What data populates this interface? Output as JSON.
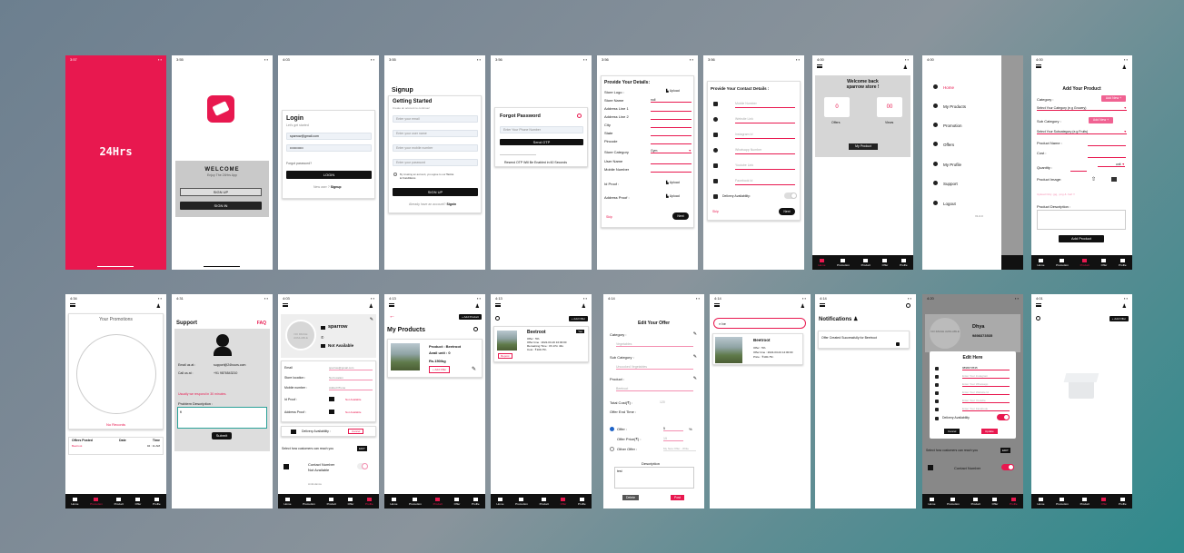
{
  "times": {
    "s1": "3:57",
    "s2": "3:55",
    "s3": "4:03",
    "s4": "3:55",
    "s5": "3:56",
    "s6": "3:56",
    "s7": "3:56",
    "s8": "4:00",
    "s9": "4:00",
    "s10": "4:00",
    "r1": "4:34",
    "r2": "4:31",
    "r3": "4:03",
    "r4": "4:13",
    "r5": "4:13",
    "r6": "4:14",
    "r7": "4:14",
    "r8": "4:14",
    "r9": "4:20",
    "r10": "4:01"
  },
  "splash": {
    "title": "24Hrs"
  },
  "welcome": {
    "title": "WELCOME",
    "subtitle": "Enjoy The 24Hrs App",
    "signup": "SIGN UP",
    "signin": "SIGN IN"
  },
  "login": {
    "title": "Login",
    "subtitle": "Let's get started",
    "email": "sparrow@gmail.com",
    "password": "••••••••••••",
    "forgot": "Forgot password?",
    "button": "LOGIN",
    "new_user": "New user ?",
    "signup_link": "Signup"
  },
  "signup": {
    "title": "Signup",
    "heading": "Getting Started",
    "sub": "Create an account to continue!",
    "email_ph": "Enter your email",
    "user_ph": "Enter your user name",
    "mobile_ph": "Enter your mobile number",
    "pass_ph": "Enter your password",
    "terms": "By creating an account, you agree to our",
    "terms_link": "Terms & Conditions",
    "button": "SIGN UP",
    "have": "Already have an account?",
    "signin": "Signin"
  },
  "forgot": {
    "title": "Forgot Password",
    "phone_ph": "Enter Your Phone Number",
    "button": "Send OTP",
    "otp_note": "Resend OTP Will Be Enabled in 60 Seconds"
  },
  "details": {
    "title": "Provide Your Details:",
    "fields": [
      "Store Logo :",
      "Store Name",
      "Address Line 1",
      "Address Line 2",
      "City",
      "State",
      "Pincode",
      "Store Category",
      "User Name",
      "Mobile Number",
      "Id Proof :",
      "Address Proof :"
    ],
    "upload": "Upload",
    "store_name": "null",
    "category": "Gym",
    "skip": "Skip",
    "next": "Next"
  },
  "contact": {
    "title": "Provide Your Contact Details :",
    "fields": [
      "Mobile Number",
      "Website Link",
      "Instagram Id",
      "Whatsapp Number",
      "Youtube Link",
      "Facebook Id"
    ],
    "delivery": "Delivery Availability:",
    "skip": "Skip",
    "next": "Next"
  },
  "home": {
    "welcome": "Welcome back",
    "store": "sparrow store !",
    "offers_val": "0",
    "views_val": "00",
    "offers": "Offers",
    "views": "Views",
    "my_product": "My Product"
  },
  "drawer": {
    "items": [
      "Home",
      "My Products",
      "Promotion",
      "Offers",
      "My Profile",
      "Support",
      "Logout"
    ],
    "version": "V1.0.0"
  },
  "add_product": {
    "title": "Add Your Product",
    "category": "Category :",
    "add_new": "Add New +",
    "cat_ph": "Select Your Category (e.g Grocery)",
    "subcategory": "Sub Category :",
    "subcat_ph": "Select Your Subcategory (e.g Fruits)",
    "name": "Product Name :",
    "cost": "Cost :",
    "qty": "Quantity :",
    "unit": "unit",
    "image": "Product Image:",
    "note": "Upload Only .jpg, .png & .heif !!",
    "desc": "Product Description :",
    "button": "Add Product"
  },
  "promotions": {
    "title": "Your Promotions",
    "no_records": "No Records",
    "cols": [
      "Offers Posted",
      "Date",
      "Time"
    ],
    "row": [
      "Beetroot",
      "",
      "04 : 11 AM"
    ]
  },
  "support": {
    "title": "Support",
    "faq": "FAQ",
    "email_label": "Email us at :",
    "email": "support@24hours.com",
    "call_label": "Call us at :",
    "phone": "+91 9876543210",
    "note": "Usually we respond in 30 minutes.",
    "desc_label": "Problem Description :",
    "desc_val": "fi",
    "button": "Submit"
  },
  "profile": {
    "no_image": "NO IMAGE AVAILABLE",
    "name": "sparrow",
    "status": "Not Available",
    "fields": [
      "Email",
      "Store location :",
      "Mobile number :",
      "Id Proof :",
      "Address Proof :"
    ],
    "email": "sparrow@gmail.com",
    "location": "Not location",
    "mobile": "Added Phone",
    "idproof": "Not Available",
    "addrproof": "Not Available",
    "delivery": "Delivery Availability :",
    "delivery_val": "Cancel",
    "reach": "Select how customers can reach you",
    "edit": "EDIT",
    "contact_label": "Contact Number",
    "contact_val": "Not Available",
    "ambulance": "Ambulance"
  },
  "my_products": {
    "title": "My Products",
    "add": "+ Add Product",
    "product": "Product : Beetroot",
    "avail": "Avail unit : 0",
    "price": "Rs.150/kg",
    "add_offer": "+ Add Offer"
  },
  "offers_list": {
    "add": "+ Add Offer",
    "name": "Beetroot",
    "badge": "Yes",
    "offer": "Offer : 5%",
    "offer_time": "Offer time : 2022-03-16 10:00:00",
    "remaining": "Remaining Time : 0h 17m 43s",
    "cost": "Cost : ₹100-75/-",
    "repost": "Repost"
  },
  "edit_offer": {
    "title": "Edit Your Offer",
    "category": "Category :",
    "cat_val": "Vegetables",
    "subcat": "Sub Category :",
    "subcat_val": "Uncooked Vegetables",
    "product": "Product :",
    "product_val": "Beetroot",
    "total_cost": "Total Cost(₹) :",
    "total_val": "120",
    "end_time": "Offer End Time :",
    "offer": "Offer :",
    "offer_val": "5",
    "percent": "%",
    "offer_price": "Offer Price(₹) :",
    "offer_price_val": "19",
    "other_offer": "Other Offer :",
    "other_ph": "My New Offer - Write",
    "description": "Description",
    "desc_val": "test",
    "delete": "Delete",
    "post": "Post"
  },
  "search": {
    "value": "be",
    "name": "Beetroot",
    "offer": "Offer : 5%",
    "offer_time": "Offer time : 2022-03-04 14:00:00",
    "price": "Price : ₹100-75/-"
  },
  "notifications": {
    "title": "Notifications",
    "item": "Offer Created Successfully for Beetroot"
  },
  "edit_here": {
    "title": "Edit Here",
    "name": "Dhya",
    "phone": "9898373535",
    "fields": [
      "9898373535",
      "Enter Your Instagram",
      "Enter Your Whatsapp",
      "Enter Your Website Id",
      "Enter Your Youtube",
      "Enter Your Facebook"
    ],
    "delivery": "Delivery Availability",
    "cancel": "Cancel",
    "update": "Update",
    "reach": "Select how customers can reach you",
    "edit": "EDIT",
    "contact": "Contact Number",
    "available": "Not Available"
  },
  "empty": {
    "add": "+ Add Offer"
  },
  "nav": [
    "Home",
    "Promotion",
    "Product",
    "Offer",
    "Profile"
  ],
  "colors": {
    "accent": "#e8184f",
    "dark": "#111111"
  }
}
